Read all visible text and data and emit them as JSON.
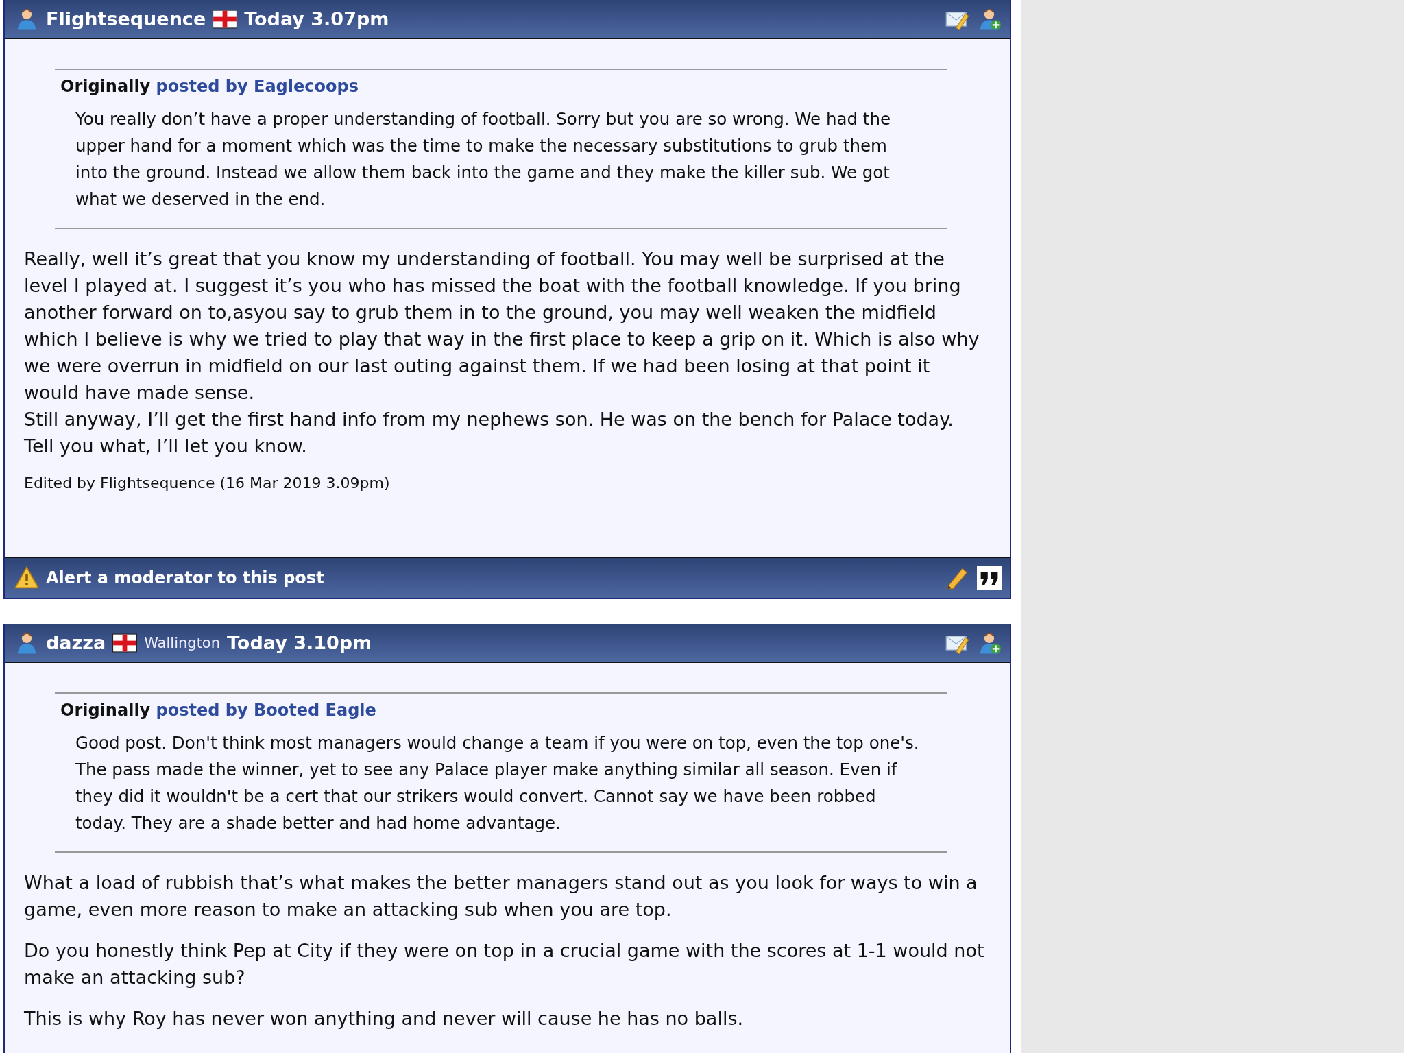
{
  "posts": [
    {
      "author": "Flightsequence",
      "time": "Today 3.07pm",
      "quote": {
        "label": "Originally",
        "by": "posted by Eaglecoops",
        "text": "You really don’t have a proper understanding of football. Sorry but you are so wrong. We had the upper hand for a moment which was the time to make the necessary substitutions to grub them into the ground. Instead we allow them back into the game and they make the killer sub. We got what we deserved in the end."
      },
      "lines": [
        "Really, well it’s great that you know my understanding of football. You may well be surprised at the level I played at. I suggest it’s you who has missed the boat with the football knowledge. If you bring another forward on to,asyou say to grub them in to the ground, you may well weaken the midfield which I believe is why we tried to play that way in the first place to keep a grip on it. Which is also why we were overrun in midfield on our last outing against them. If we had been losing at that point it would have made sense.",
        "Still anyway, I’ll get the first hand info from my nephews son. He was on the bench for Palace today.",
        "Tell you what, I’ll let you know."
      ],
      "edited": "Edited by Flightsequence (16 Mar 2019 3.09pm)",
      "footer": {
        "alert": "Alert a moderator to this post"
      }
    },
    {
      "author": "dazza",
      "location": "Wallington",
      "time": "Today 3.10pm",
      "quote": {
        "label": "Originally",
        "by": "posted by Booted Eagle",
        "text": "Good post. Don't think most managers would change a team if you were on top, even the top one's. The pass made the winner, yet to see any Palace player make anything similar all season. Even if they did it wouldn't be a cert that our strikers would convert. Cannot say we have been robbed today. They are a shade better and had home advantage."
      },
      "paragraphs": [
        "What a load of rubbish that’s what makes the better managers stand out as you look for ways to win a game, even more reason to make an attacking sub when you are top.",
        "Do you honestly think Pep at City if they were on top in a crucial game with the scores at 1-1 would not make an attacking sub?",
        "This is why Roy has never won anything and never will cause he has no balls."
      ]
    }
  ]
}
